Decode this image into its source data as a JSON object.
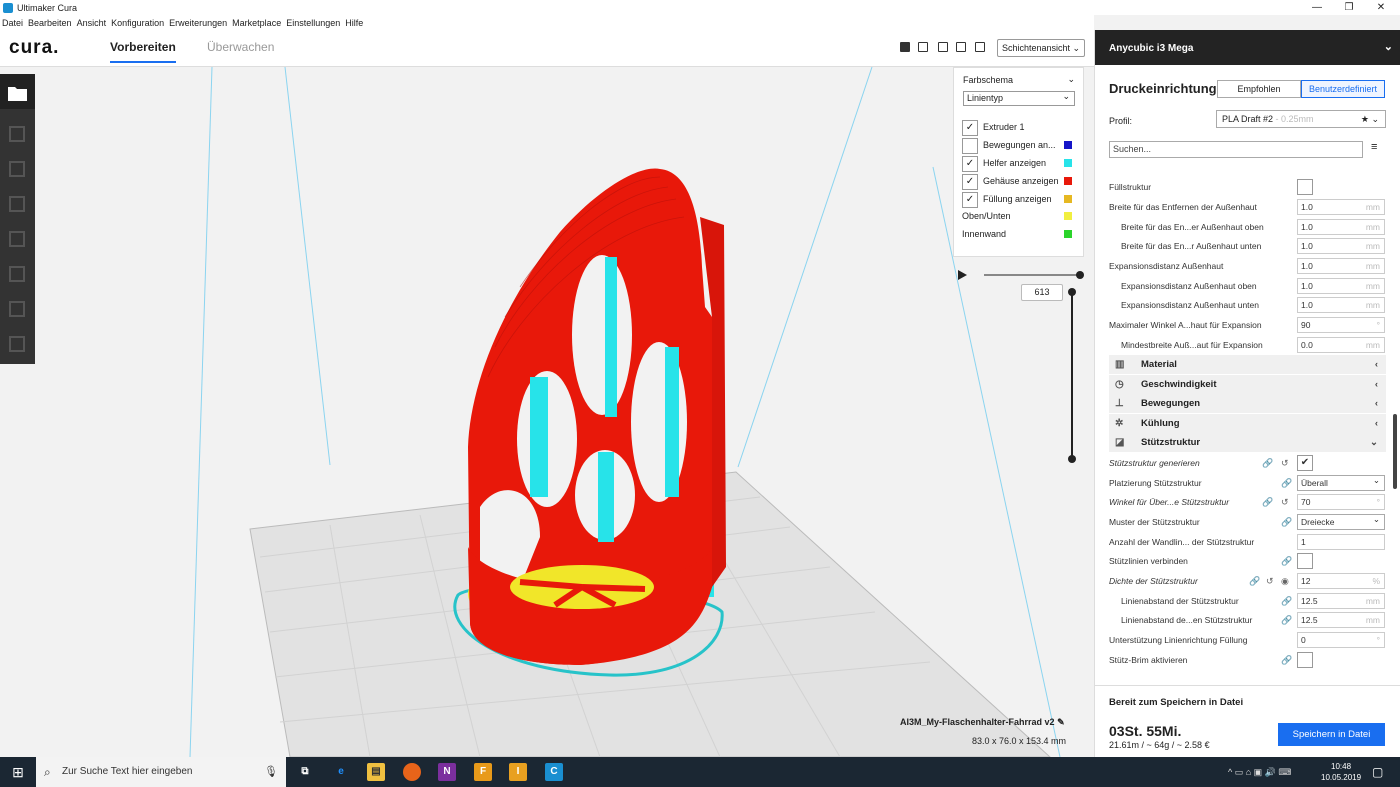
{
  "window": {
    "title": "Ultimaker Cura",
    "min": "—",
    "max": "❐",
    "close": "✕"
  },
  "menu": [
    "Datei",
    "Bearbeiten",
    "Ansicht",
    "Konfiguration",
    "Erweiterungen",
    "Marketplace",
    "Einstellungen",
    "Hilfe"
  ],
  "nav": {
    "logo": "cura.",
    "tabs": [
      "Vorbereiten",
      "Überwachen"
    ],
    "view_select": "Schichtenansicht"
  },
  "colors": {
    "accent": "#196ef0",
    "shell": "#e8180a",
    "infill": "#f1e629",
    "support": "#27e3e9",
    "build_plate": "#e6e6e6"
  },
  "color_panel": {
    "title": "Farbschema",
    "scheme": "Linientyp",
    "items": [
      {
        "label": "Extruder 1",
        "checked": true,
        "color": ""
      },
      {
        "label": "Bewegungen an...",
        "checked": false,
        "color": "#1515c8"
      },
      {
        "label": "Helfer anzeigen",
        "checked": true,
        "color": "#27e3e9"
      },
      {
        "label": "Gehäuse anzeigen",
        "checked": true,
        "color": "#e8180a"
      },
      {
        "label": "Füllung anzeigen",
        "checked": true,
        "color": "#e6b822"
      }
    ],
    "legend": [
      {
        "label": "Oben/Unten",
        "color": "#f1ef40"
      },
      {
        "label": "Innenwand",
        "color": "#2bd42b"
      }
    ]
  },
  "layer": {
    "current": "613"
  },
  "model": {
    "filename": "AI3M_My-Flaschenhalter-Fahrrad v2",
    "dimensions": "83.0 x 76.0 x 153.4 mm"
  },
  "panel": {
    "printer": "Anycubic i3 Mega",
    "title": "Druckeinrichtung",
    "mode_recommended": "Empfohlen",
    "mode_custom": "Benutzerdefiniert",
    "profile_label": "Profil:",
    "profile_value": "PLA Draft #2",
    "profile_dim": "- 0.25mm",
    "search_placeholder": "Suchen...",
    "settings": [
      {
        "label": "Füllstruktur",
        "type": "check",
        "value": "",
        "indent": 0
      },
      {
        "label": "Breite für das Entfernen der Außenhaut",
        "type": "input",
        "value": "1.0",
        "unit": "mm",
        "indent": 0
      },
      {
        "label": "Breite für das En...er Außenhaut oben",
        "type": "input",
        "value": "1.0",
        "unit": "mm",
        "indent": 1
      },
      {
        "label": "Breite für das En...r Außenhaut unten",
        "type": "input",
        "value": "1.0",
        "unit": "mm",
        "indent": 1
      },
      {
        "label": "Expansionsdistanz Außenhaut",
        "type": "input",
        "value": "1.0",
        "unit": "mm",
        "indent": 0
      },
      {
        "label": "Expansionsdistanz Außenhaut oben",
        "type": "input",
        "value": "1.0",
        "unit": "mm",
        "indent": 1
      },
      {
        "label": "Expansionsdistanz Außenhaut unten",
        "type": "input",
        "value": "1.0",
        "unit": "mm",
        "indent": 1
      },
      {
        "label": "Maximaler Winkel A...haut für Expansion",
        "type": "input",
        "value": "90",
        "unit": "°",
        "indent": 0
      },
      {
        "label": "Mindestbreite Auß...aut für Expansion",
        "type": "input",
        "value": "0.0",
        "unit": "mm",
        "indent": 1
      }
    ],
    "categories": [
      "Material",
      "Geschwindigkeit",
      "Bewegungen",
      "Kühlung",
      "Stützstruktur"
    ],
    "support": [
      {
        "label": "Stützstruktur generieren",
        "type": "check",
        "value": "✔",
        "italic": true,
        "indent": 0
      },
      {
        "label": "Platzierung Stützstruktur",
        "type": "select",
        "value": "Überall",
        "indent": 0
      },
      {
        "label": "Winkel für Über...e Stützstruktur",
        "type": "input",
        "value": "70",
        "unit": "°",
        "italic": true,
        "indent": 0
      },
      {
        "label": "Muster der Stützstruktur",
        "type": "select",
        "value": "Dreiecke",
        "indent": 0
      },
      {
        "label": "Anzahl der Wandlin... der Stützstruktur",
        "type": "input",
        "value": "1",
        "unit": "",
        "indent": 0
      },
      {
        "label": "Stützlinien verbinden",
        "type": "check",
        "value": "",
        "indent": 0
      },
      {
        "label": "Dichte der Stützstruktur",
        "type": "input",
        "value": "12",
        "unit": "%",
        "italic": true,
        "indent": 0
      },
      {
        "label": "Linienabstand der Stützstruktur",
        "type": "input",
        "value": "12.5",
        "unit": "mm",
        "indent": 1
      },
      {
        "label": "Linienabstand de...en Stützstruktur",
        "type": "input",
        "value": "12.5",
        "unit": "mm",
        "indent": 1
      },
      {
        "label": "Unterstützung Linienrichtung Füllung",
        "type": "input",
        "value": "0",
        "unit": "°",
        "indent": 0
      },
      {
        "label": "Stütz-Brim aktivieren",
        "type": "check",
        "value": "",
        "indent": 0
      }
    ],
    "ready": "Bereit zum Speichern in Datei",
    "print_time": "03St. 55Mi.",
    "print_info": "21.61m / ~ 64g / ~ 2.58 €",
    "save_button": "Speichern in Datei"
  },
  "taskbar": {
    "start": "⊞",
    "search_placeholder": "Zur Suche Text hier eingeben",
    "time": "10:48",
    "date": "10.05.2019"
  }
}
